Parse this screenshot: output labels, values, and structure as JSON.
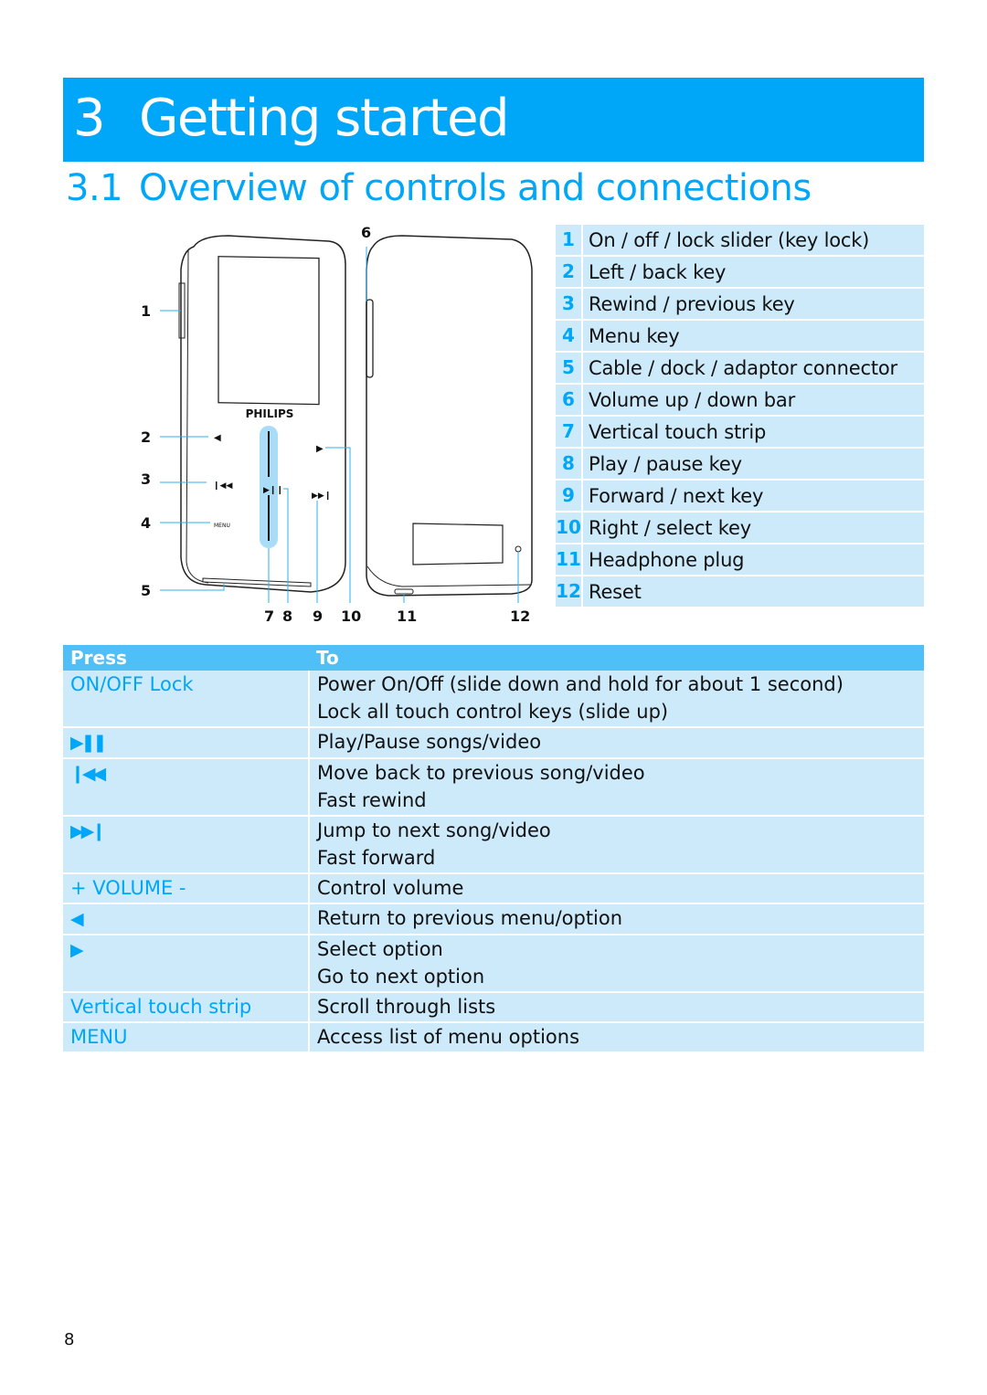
{
  "chapter": {
    "number": "3",
    "title": "Getting started"
  },
  "section": {
    "number": "3.1",
    "title": "Overview of controls and connections"
  },
  "figure": {
    "brand": "PHILIPS",
    "menu_label": "MENU",
    "callouts": [
      "1",
      "2",
      "3",
      "4",
      "5",
      "6",
      "7",
      "8",
      "9",
      "10",
      "11",
      "12"
    ]
  },
  "legend": [
    {
      "num": "1",
      "label": "On / off / lock slider (key lock)"
    },
    {
      "num": "2",
      "label": "Left / back key"
    },
    {
      "num": "3",
      "label": "Rewind / previous key"
    },
    {
      "num": "4",
      "label": "Menu key"
    },
    {
      "num": "5",
      "label": "Cable / dock / adaptor connector"
    },
    {
      "num": "6",
      "label": "Volume up / down bar"
    },
    {
      "num": "7",
      "label": "Vertical touch strip"
    },
    {
      "num": "8",
      "label": "Play / pause key"
    },
    {
      "num": "9",
      "label": "Forward / next key"
    },
    {
      "num": "10",
      "label": "Right / select key"
    },
    {
      "num": "11",
      "label": "Headphone plug"
    },
    {
      "num": "12",
      "label": "Reset"
    }
  ],
  "table": {
    "headers": {
      "press": "Press",
      "to": "To"
    },
    "rows": [
      {
        "key": "ON/OFF Lock",
        "key_icon": "",
        "actions": [
          "Power On/Off (slide down and hold for about 1 second)",
          "Lock all touch control keys (slide up)"
        ]
      },
      {
        "key": "",
        "key_icon": "play-pause-icon",
        "glyph": "▶❚❚",
        "actions": [
          "Play/Pause songs/video"
        ]
      },
      {
        "key": "",
        "key_icon": "previous-icon",
        "glyph": "❙◀◀",
        "actions": [
          "Move back to previous song/video",
          "Fast rewind"
        ]
      },
      {
        "key": "",
        "key_icon": "next-icon",
        "glyph": "▶▶❙",
        "actions": [
          "Jump to next song/video",
          "Fast forward"
        ]
      },
      {
        "key": "+ VOLUME -",
        "key_icon": "",
        "actions": [
          "Control volume"
        ]
      },
      {
        "key": "",
        "key_icon": "left-arrow-icon",
        "glyph": "◀",
        "actions": [
          "Return to previous menu/option"
        ]
      },
      {
        "key": "",
        "key_icon": "right-arrow-icon",
        "glyph": "▶",
        "actions": [
          "Select option",
          "Go to next option"
        ]
      },
      {
        "key": "Vertical touch strip",
        "key_icon": "",
        "actions": [
          "Scroll through lists"
        ]
      },
      {
        "key": "MENU",
        "key_icon": "",
        "actions": [
          "Access list of menu options"
        ]
      }
    ]
  },
  "page_number": "8",
  "colors": {
    "accent": "#00a6f7",
    "header_row": "#4fbff8",
    "row_fill": "#cdeafb"
  }
}
